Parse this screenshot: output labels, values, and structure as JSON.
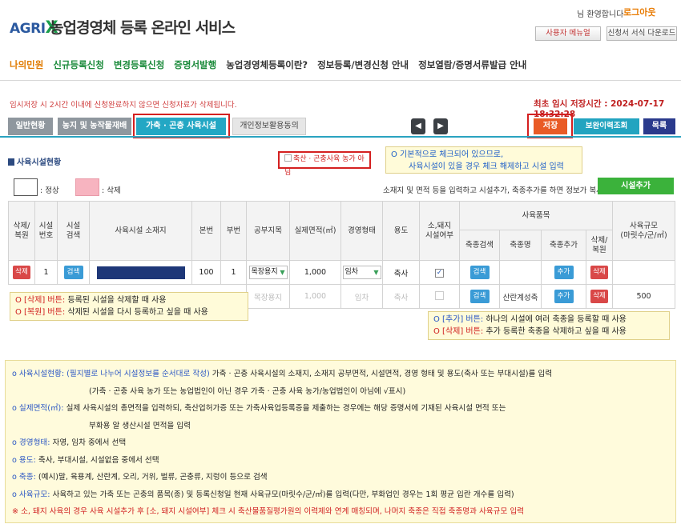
{
  "header": {
    "logo_text": "AGRI",
    "logo_x": "X",
    "title": "농업경영체 등록 온라인 서비스",
    "welcome": "님 환영합니다",
    "logout": "로그아웃",
    "manual_btn": "사용자 메뉴얼",
    "download_btn": "신청서 서식 다운로드"
  },
  "nav": {
    "items": [
      "나의민원",
      "신규등록신청",
      "변경등록신청",
      "증명서발행",
      "농업경영체등록이란?",
      "정보등록/변경신청 안내",
      "정보열람/증명서류발급 안내"
    ]
  },
  "notice": {
    "warning": "임시저장 시 2시간 이내에 신청완료하지 않으면 신청자료가 삭제됩니다.",
    "save_time": "최초 임시 저장시간 : 2024-07-17 18:32:28"
  },
  "tabs": [
    "일반현황",
    "농지 및 농작물재배",
    "가축 · 곤충 사육시설",
    "개인정보활용동의"
  ],
  "toolbar": {
    "prev": "◀",
    "next": "▶",
    "save": "저장",
    "history": "보완이력조회",
    "list": "목록"
  },
  "section": {
    "title": "사육시설현황",
    "nonfarm_check": "축산 · 곤충사육 농가 아님",
    "annot_top_1": "O 기본적으로 체크되어 있으므로,",
    "annot_top_2": "사육시설이 있을 경우 체크 해제하고 시설 입력",
    "legend_normal": ": 정상",
    "legend_deleted": ": 삭제",
    "copy_note": "소재지 및 면적 등을 입력하고 시설추가, 축종추가를 하면 정보가 복사됩니다.",
    "add_facility": "시설추가"
  },
  "table": {
    "headers": {
      "del_restore": "삭제/\n복원",
      "facility_no": "시설\n번호",
      "facility_search": "시설\n검색",
      "location": "사육시설 소재지",
      "main_no": "본번",
      "sub_no": "부번",
      "land_category": "공부지목",
      "actual_area": "실제면적(㎡)",
      "mgmt_type": "경영형태",
      "use": "용도",
      "cattle_pig": "소,돼지\n시설여부",
      "breed_group": "사육품목",
      "breed_search": "축종검색",
      "breed_name": "축종명",
      "breed_add": "축종추가",
      "breed_del": "삭제/\n복원",
      "scale": "사육규모\n(마릿수/군/㎡)"
    },
    "rows": [
      {
        "del": "삭제",
        "no": "1",
        "search": "검색",
        "main_no": "100",
        "sub_no": "1",
        "land": "목장용지",
        "area": "1,000",
        "mgmt": "임차",
        "use": "축사",
        "checked": "✓",
        "b_search": "검색",
        "b_name": "",
        "b_add": "추가",
        "b_del": "삭제",
        "scale": ""
      },
      {
        "del": "",
        "no": "",
        "search": "",
        "main_no": "",
        "sub_no": "",
        "land": "목장용지",
        "area": "1,000",
        "mgmt": "임차",
        "use": "축사",
        "checked": "",
        "b_search": "검색",
        "b_name": "산란계성축",
        "b_add": "추가",
        "b_del": "삭제",
        "scale": "500"
      }
    ]
  },
  "annotations": {
    "left_1_label": "O [삭제] 버튼:",
    "left_1_text": "등록된 시설을 삭제할 때 사용",
    "left_2_label": "O [복원] 버튼:",
    "left_2_text": "삭제된 시설을 다시 등록하고 싶을 때 사용",
    "right_1_label": "O [추가] 버튼:",
    "right_1_text": "하나의 시설에 여러 축종을 등록할 때 사용",
    "right_2_label": "O [삭제] 버튼:",
    "right_2_text": "추가 등록한 축종을 삭제하고 싶을 때 사용"
  },
  "info": {
    "l1_label": "o 사육시설현황:",
    "l1_blue": "(필지별로 나누어 시설정보를 순서대로 작성)",
    "l1_text": "가축 · 곤충 사육시설의 소재지, 소재지 공부면적, 시설면적, 경영 형태 및 용도(축사 또는 부대시설)를 입력",
    "l1b_text": "(가축 · 곤충 사육 농가 또는 농업법인이 아닌 경우 가축 · 곤충 사육 농가/농업법인이 아님에 √표시)",
    "l2_label": "o 실제면적(㎡):",
    "l2_text": "실제 사육시설의 총면적을 입력하되, 축산업허가증 또는 가축사육업등록증을 제출하는 경우에는 해당 증명서에 기재된 사육시설 면적 또는",
    "l2b_text": "부화용 알 생산시설 면적을 입력",
    "l3_label": "o 경영형태:",
    "l3_text": "자영, 임차 중에서 선택",
    "l4_label": "o 용도:",
    "l4_text": "축사, 부대시설, 시설없음 중에서 선택",
    "l5_label": "o 축종:",
    "l5_text": "(예시)말, 육용계, 산란계, 오리, 거위, 벌류, 곤충류, 지렁이 등으로 검색",
    "l6_label": "o 사육규모:",
    "l6_text": "사육하고 있는 가축 또는 곤충의 품목(종) 및 등록신청일 현재 사육규모(마릿수/군/㎡)를 입력(다만, 부화업인 경우는 1회 평균 입란 개수를 입력)",
    "note": "※ 소, 돼지 사육의 경우 사육 시설추가 후 [소, 돼지 시설여부] 체크 시 축산물품질평가원의 이력제와 연계 매칭되며, 나머지 축종은 직접 축종명과 사육규모 입력"
  }
}
